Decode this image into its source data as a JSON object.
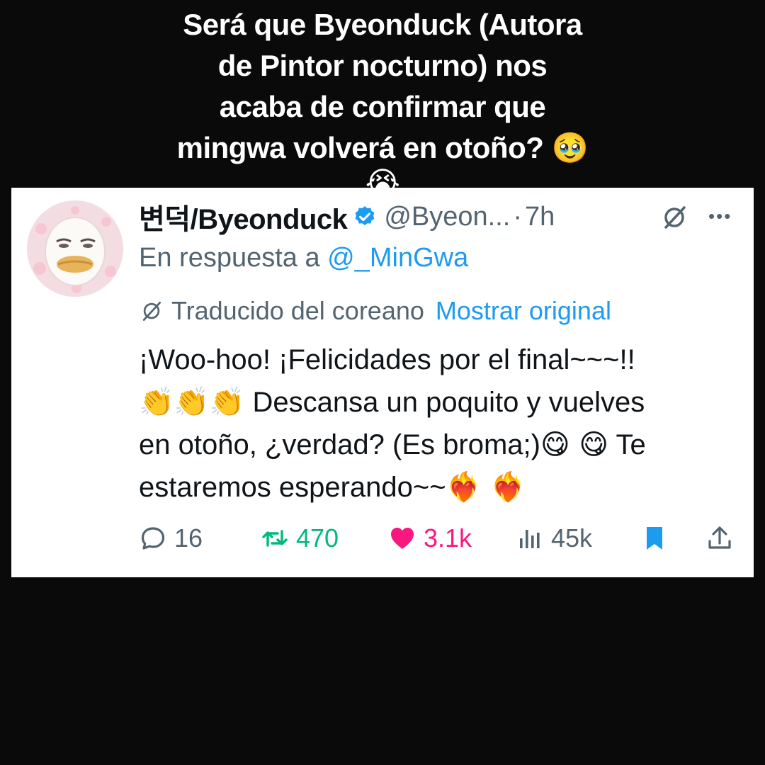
{
  "caption": {
    "line1": "Será que Byeonduck (Autora",
    "line2": "de Pintor nocturno) nos",
    "line3": "acaba de confirmar que",
    "line4": "mingwa volverá en otoño?",
    "emoji1": "🥹",
    "emoji2": "😭"
  },
  "tweet": {
    "display_name": "변덕/Byeonduck",
    "handle": "@Byeon...",
    "separator": "·",
    "time": "7h",
    "reply_prefix": "En respuesta a",
    "reply_mention": "@_MinGwa",
    "translated_label": "Traducido del coreano",
    "show_original": "Mostrar original",
    "text_line1": "¡Woo-hoo! ¡Felicidades por el final~~~!!",
    "clap_emojis": "👏👏👏",
    "text_line2": "Descansa un poquito y vuelves",
    "text_line3": "en otoño, ¿verdad? (Es broma;)",
    "yum_emojis": "😋 😋",
    "text_line3b": "Te",
    "text_line4": "estaremos esperando~~",
    "heart_emojis": "❤️‍🔥 ❤️‍🔥"
  },
  "actions": {
    "replies": "16",
    "retweets": "470",
    "likes": "3.1k",
    "views": "45k"
  },
  "colors": {
    "background": "#0a0a0a",
    "card": "#ffffff",
    "link_blue": "#1d9bf0",
    "retweet_green": "#00ba7c",
    "like_pink": "#f91880",
    "muted_gray": "#536471"
  }
}
